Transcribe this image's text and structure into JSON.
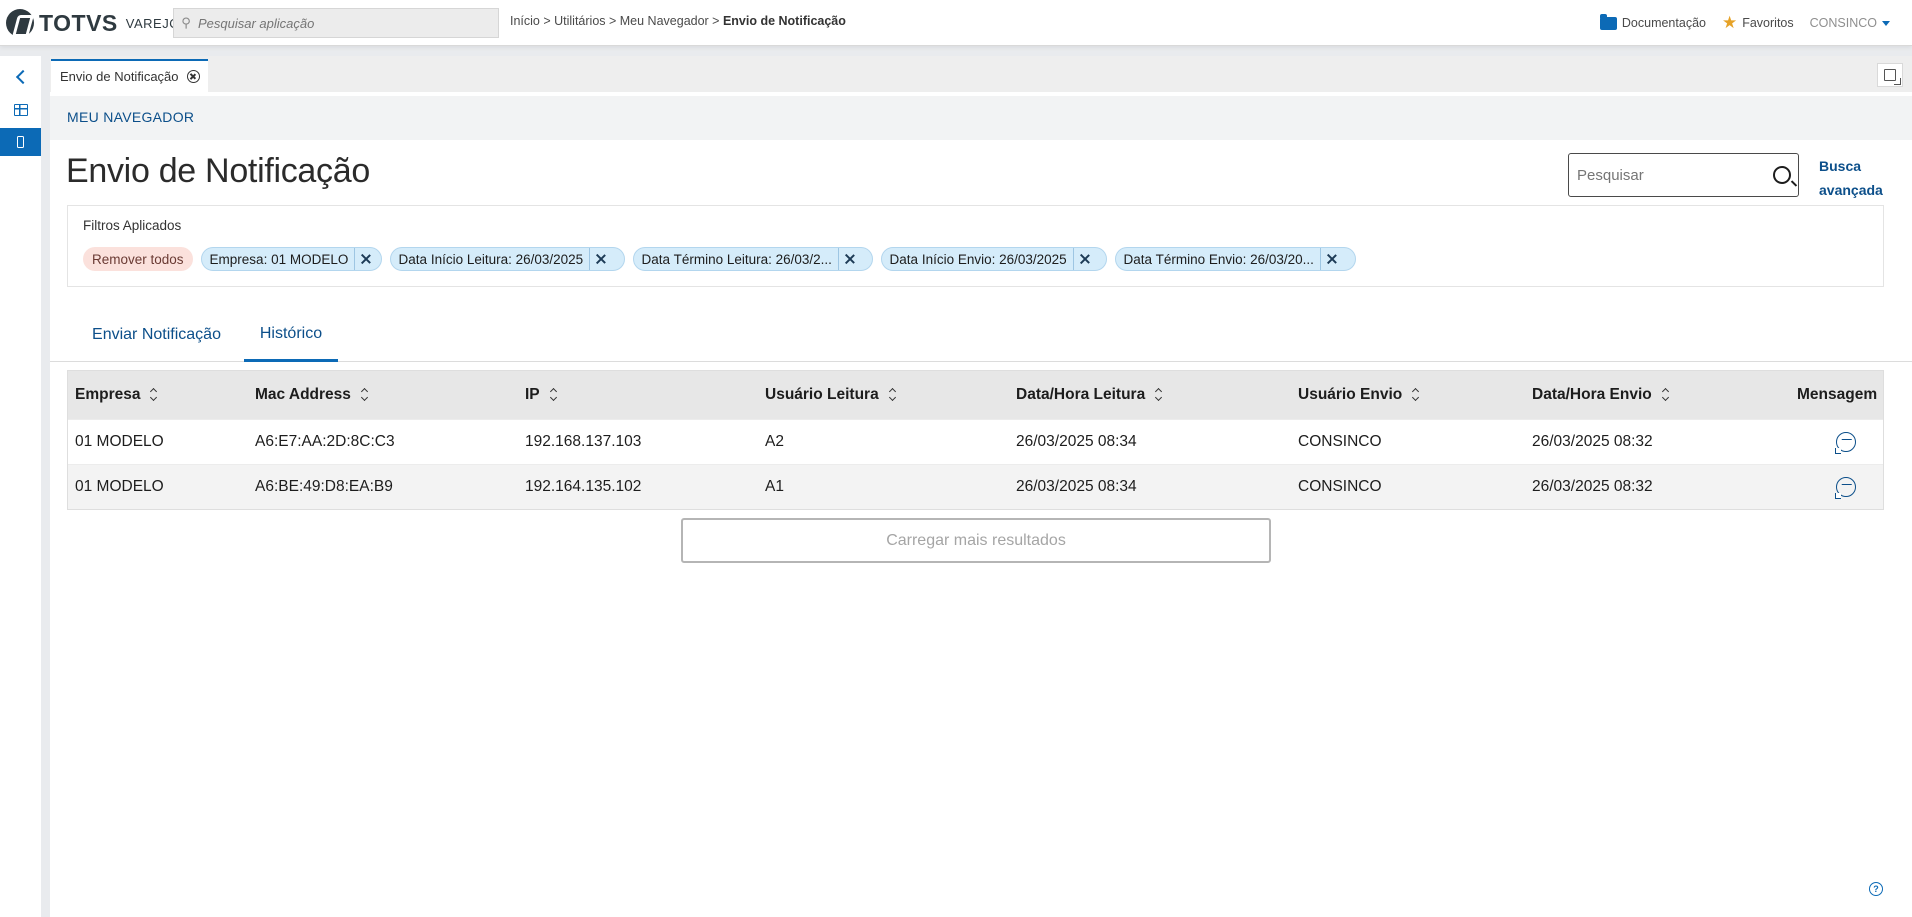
{
  "header": {
    "brand": "TOTVS",
    "product": "VAREJO",
    "app_search_placeholder": "Pesquisar aplicação",
    "breadcrumb": {
      "path": "Início > Utilitários > Meu Navegador > ",
      "current": "Envio de Notificação"
    },
    "links": {
      "documentation": "Documentação",
      "favorites": "Favoritos",
      "user": "CONSINCO"
    }
  },
  "doc_tab": {
    "label": "Envio de Notificação"
  },
  "section_label": "MEU NAVEGADOR",
  "page": {
    "title": "Envio de Notificação",
    "search_placeholder": "Pesquisar",
    "advanced_search": "Busca avançada"
  },
  "filters": {
    "label": "Filtros Aplicados",
    "remove_all": "Remover todos",
    "chips": [
      "Empresa: 01 MODELO",
      "Data Início Leitura: 26/03/2025",
      "Data Término Leitura: 26/03/2...",
      "Data Início Envio: 26/03/2025",
      "Data Término Envio: 26/03/20..."
    ]
  },
  "tabs": [
    {
      "label": "Enviar Notificação",
      "active": false
    },
    {
      "label": "Histórico",
      "active": true
    }
  ],
  "table": {
    "columns": [
      "Empresa",
      "Mac Address",
      "IP",
      "Usuário Leitura",
      "Data/Hora Leitura",
      "Usuário Envio",
      "Data/Hora Envio",
      "Mensagem"
    ],
    "rows": [
      [
        "01 MODELO",
        "A6:E7:AA:2D:8C:C3",
        "192.168.137.103",
        "A2",
        "26/03/2025 08:34",
        "CONSINCO",
        "26/03/2025 08:32"
      ],
      [
        "01 MODELO",
        "A6:BE:49:D8:EA:B9",
        "192.164.135.102",
        "A1",
        "26/03/2025 08:34",
        "CONSINCO",
        "26/03/2025 08:32"
      ]
    ]
  },
  "load_more": "Carregar mais resultados",
  "colors": {
    "accent": "#0c6ab6",
    "link": "#0c4f8a",
    "chip_bg": "#d5ecfa",
    "remove_chip_bg": "#fbe1dc",
    "favorite_star": "#e6a227"
  }
}
